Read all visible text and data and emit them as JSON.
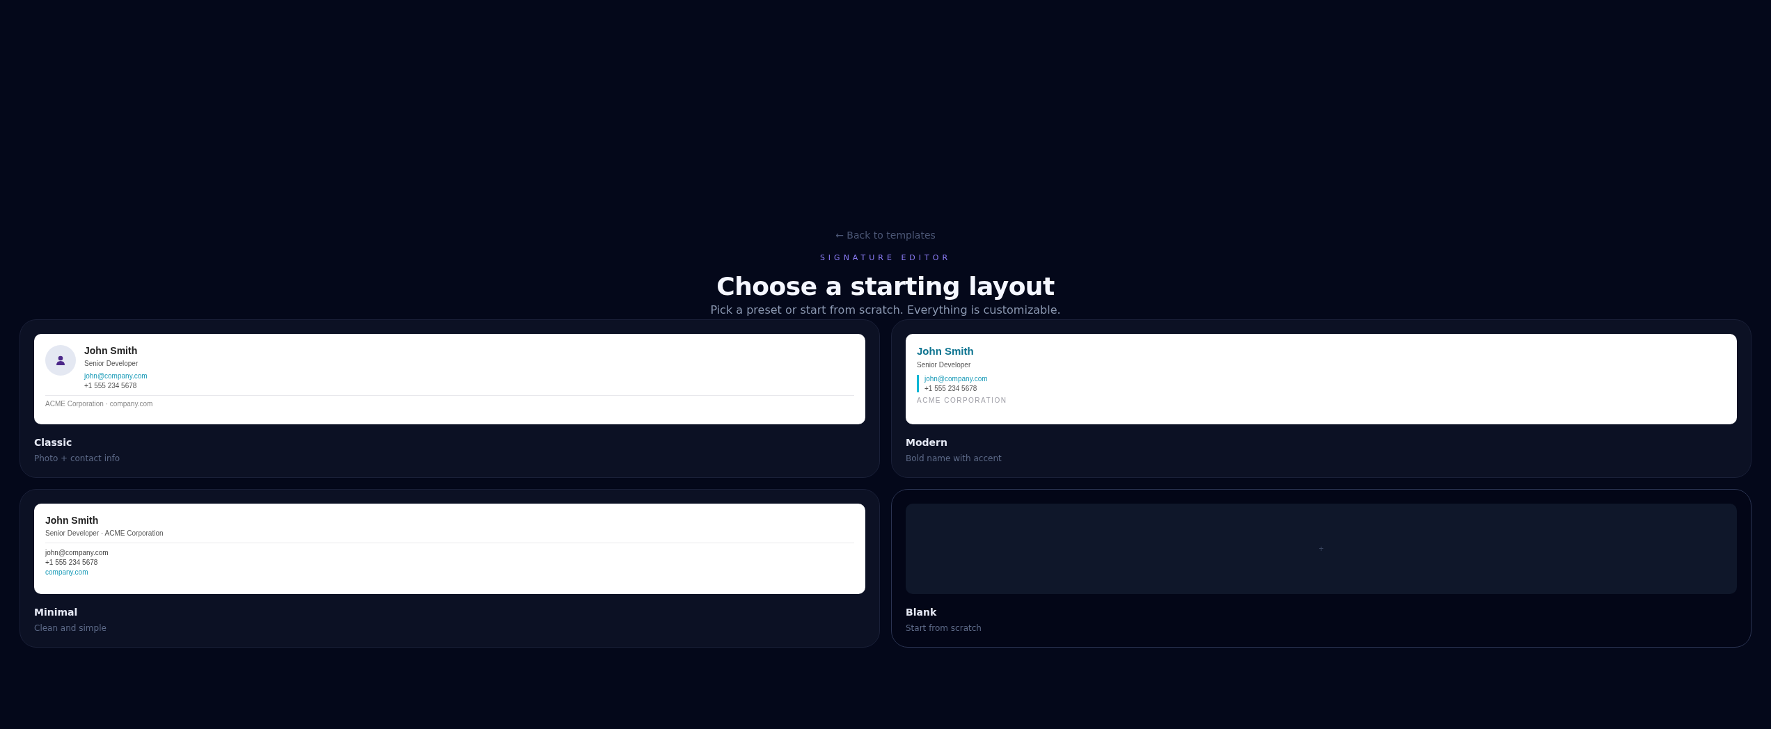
{
  "header": {
    "back_link": "← Back to templates",
    "eyebrow": "SIGNATURE EDITOR",
    "title": "Choose a starting layout",
    "subtitle": "Pick a preset or start from scratch. Everything is customizable."
  },
  "layouts": [
    {
      "kind": "classic",
      "name": "Classic",
      "description": "Photo + contact info",
      "preview": {
        "name": "John Smith",
        "role": "Senior Developer",
        "email": "john@company.com",
        "phone": "+1 555 234 5678",
        "footer": "ACME Corporation · company.com"
      }
    },
    {
      "kind": "modern",
      "name": "Modern",
      "description": "Bold name with accent",
      "preview": {
        "name": "John Smith",
        "role": "Senior Developer",
        "email": "john@company.com",
        "phone": "+1 555 234 5678",
        "company": "ACME CORPORATION"
      }
    },
    {
      "kind": "minimal",
      "name": "Minimal",
      "description": "Clean and simple",
      "preview": {
        "name": "John Smith",
        "role": "Senior Developer · ACME Corporation",
        "email": "john@company.com",
        "phone": "+1 555 234 5678",
        "website": "company.com"
      }
    },
    {
      "kind": "blank",
      "name": "Blank",
      "description": "Start from scratch",
      "preview": {
        "symbol": "+"
      }
    }
  ]
}
